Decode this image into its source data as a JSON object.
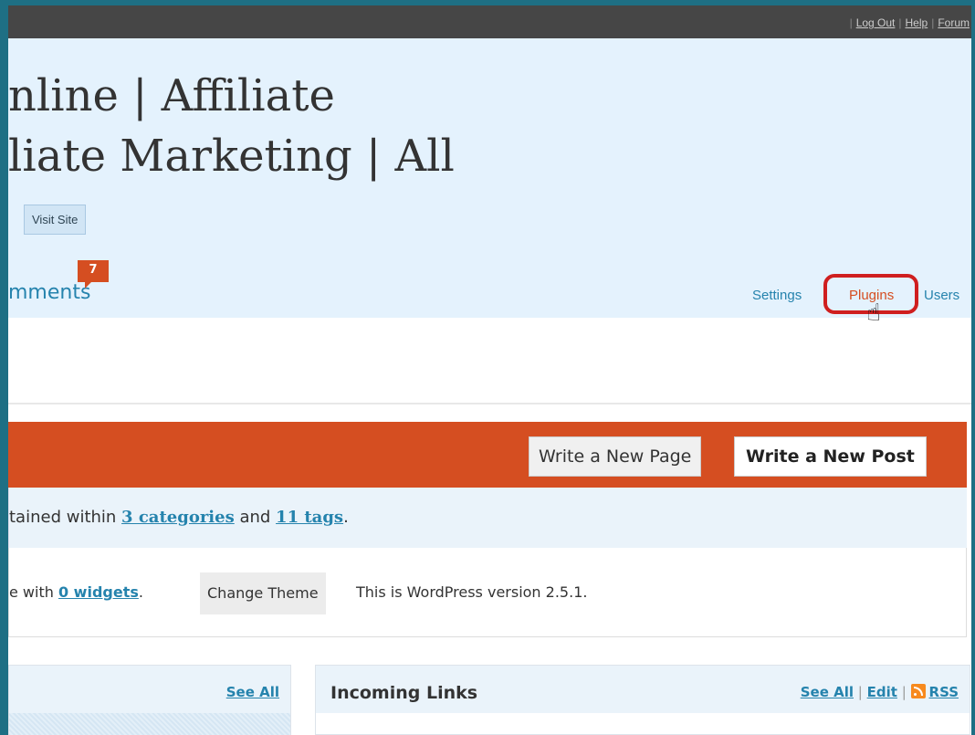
{
  "topbar": {
    "links": [
      "Log Out",
      "Help",
      "Forum"
    ]
  },
  "header": {
    "title_line1": "nline | Affiliate",
    "title_line2": "liate Marketing | All",
    "visit_site": "Visit Site",
    "nav_comments": "mments",
    "comments_badge": "7",
    "subnav": {
      "settings": "Settings",
      "plugins": "Plugins",
      "users": "Users"
    }
  },
  "actions": {
    "new_page": "Write a New Page",
    "new_post": "Write a New Post"
  },
  "stats": {
    "prefix": "tained within ",
    "categories": "3 categories",
    "and": " and ",
    "tags": "11 tags",
    "suffix": "."
  },
  "theme": {
    "prefix": "e with ",
    "widgets": "0 widgets",
    "suffix": ".",
    "change_theme": "Change Theme",
    "version_text": "This is WordPress version 2.5.1."
  },
  "widgets": {
    "left": {
      "see_all": "See All"
    },
    "right": {
      "title": "Incoming Links",
      "see_all": "See All",
      "edit": "Edit",
      "rss": "RSS"
    }
  },
  "colors": {
    "accent_orange": "#d54e21",
    "link_blue": "#2583ad",
    "header_bg": "#e4f2fd",
    "highlight_ring": "#cf1f1f"
  }
}
